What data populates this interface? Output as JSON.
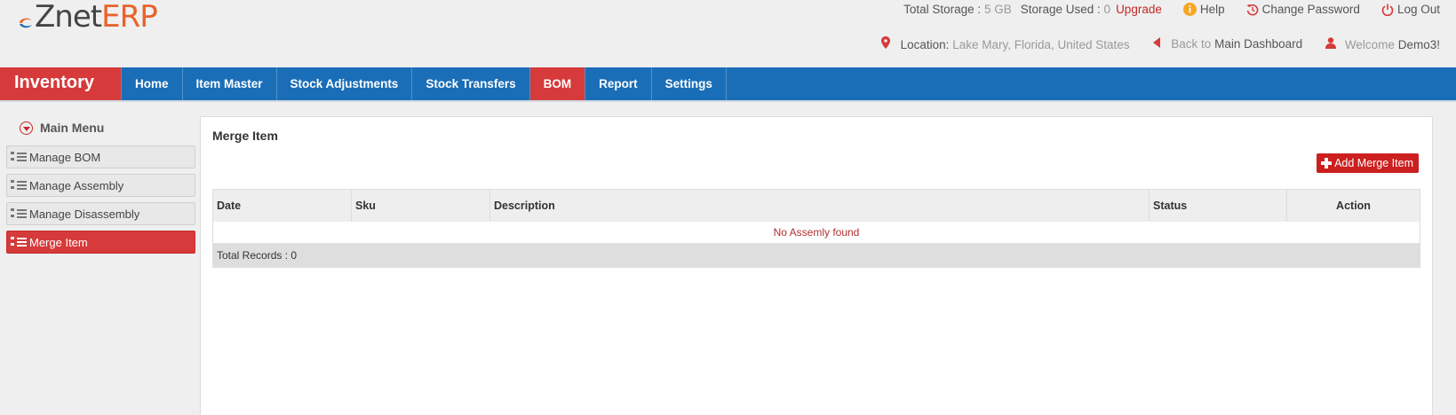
{
  "brand": {
    "logo_znet": "Znet",
    "logo_erp": "ERP"
  },
  "top": {
    "total_storage_label": "Total Storage :",
    "total_storage_value": "5 GB",
    "storage_used_label": "Storage Used :",
    "storage_used_value": "0",
    "upgrade": "Upgrade",
    "help": "Help",
    "change_password": "Change Password",
    "logout": "Log Out",
    "location_label": "Location:",
    "location_value": "Lake Mary, Florida, United States",
    "back_to": "Back to",
    "main_dashboard": "Main Dashboard",
    "welcome": "Welcome",
    "user": "Demo3!"
  },
  "nav": {
    "brand": "Inventory",
    "items": [
      "Home",
      "Item Master",
      "Stock Adjustments",
      "Stock Transfers",
      "BOM",
      "Report",
      "Settings"
    ],
    "active": "BOM"
  },
  "sidebar": {
    "title": "Main Menu",
    "items": [
      "Manage BOM",
      "Manage Assembly",
      "Manage Disassembly",
      "Merge Item"
    ],
    "active": "Merge Item"
  },
  "main": {
    "title": "Merge Item",
    "add_button": "Add Merge Item",
    "columns": [
      "Date",
      "Sku",
      "Description",
      "Status",
      "Action"
    ],
    "empty_message": "No Assemly found",
    "total_records_label": "Total Records :",
    "total_records": "0"
  },
  "colors": {
    "accent_red": "#d63a3a",
    "nav_blue": "#1a6eb7",
    "logo_orange": "#e8632b"
  }
}
